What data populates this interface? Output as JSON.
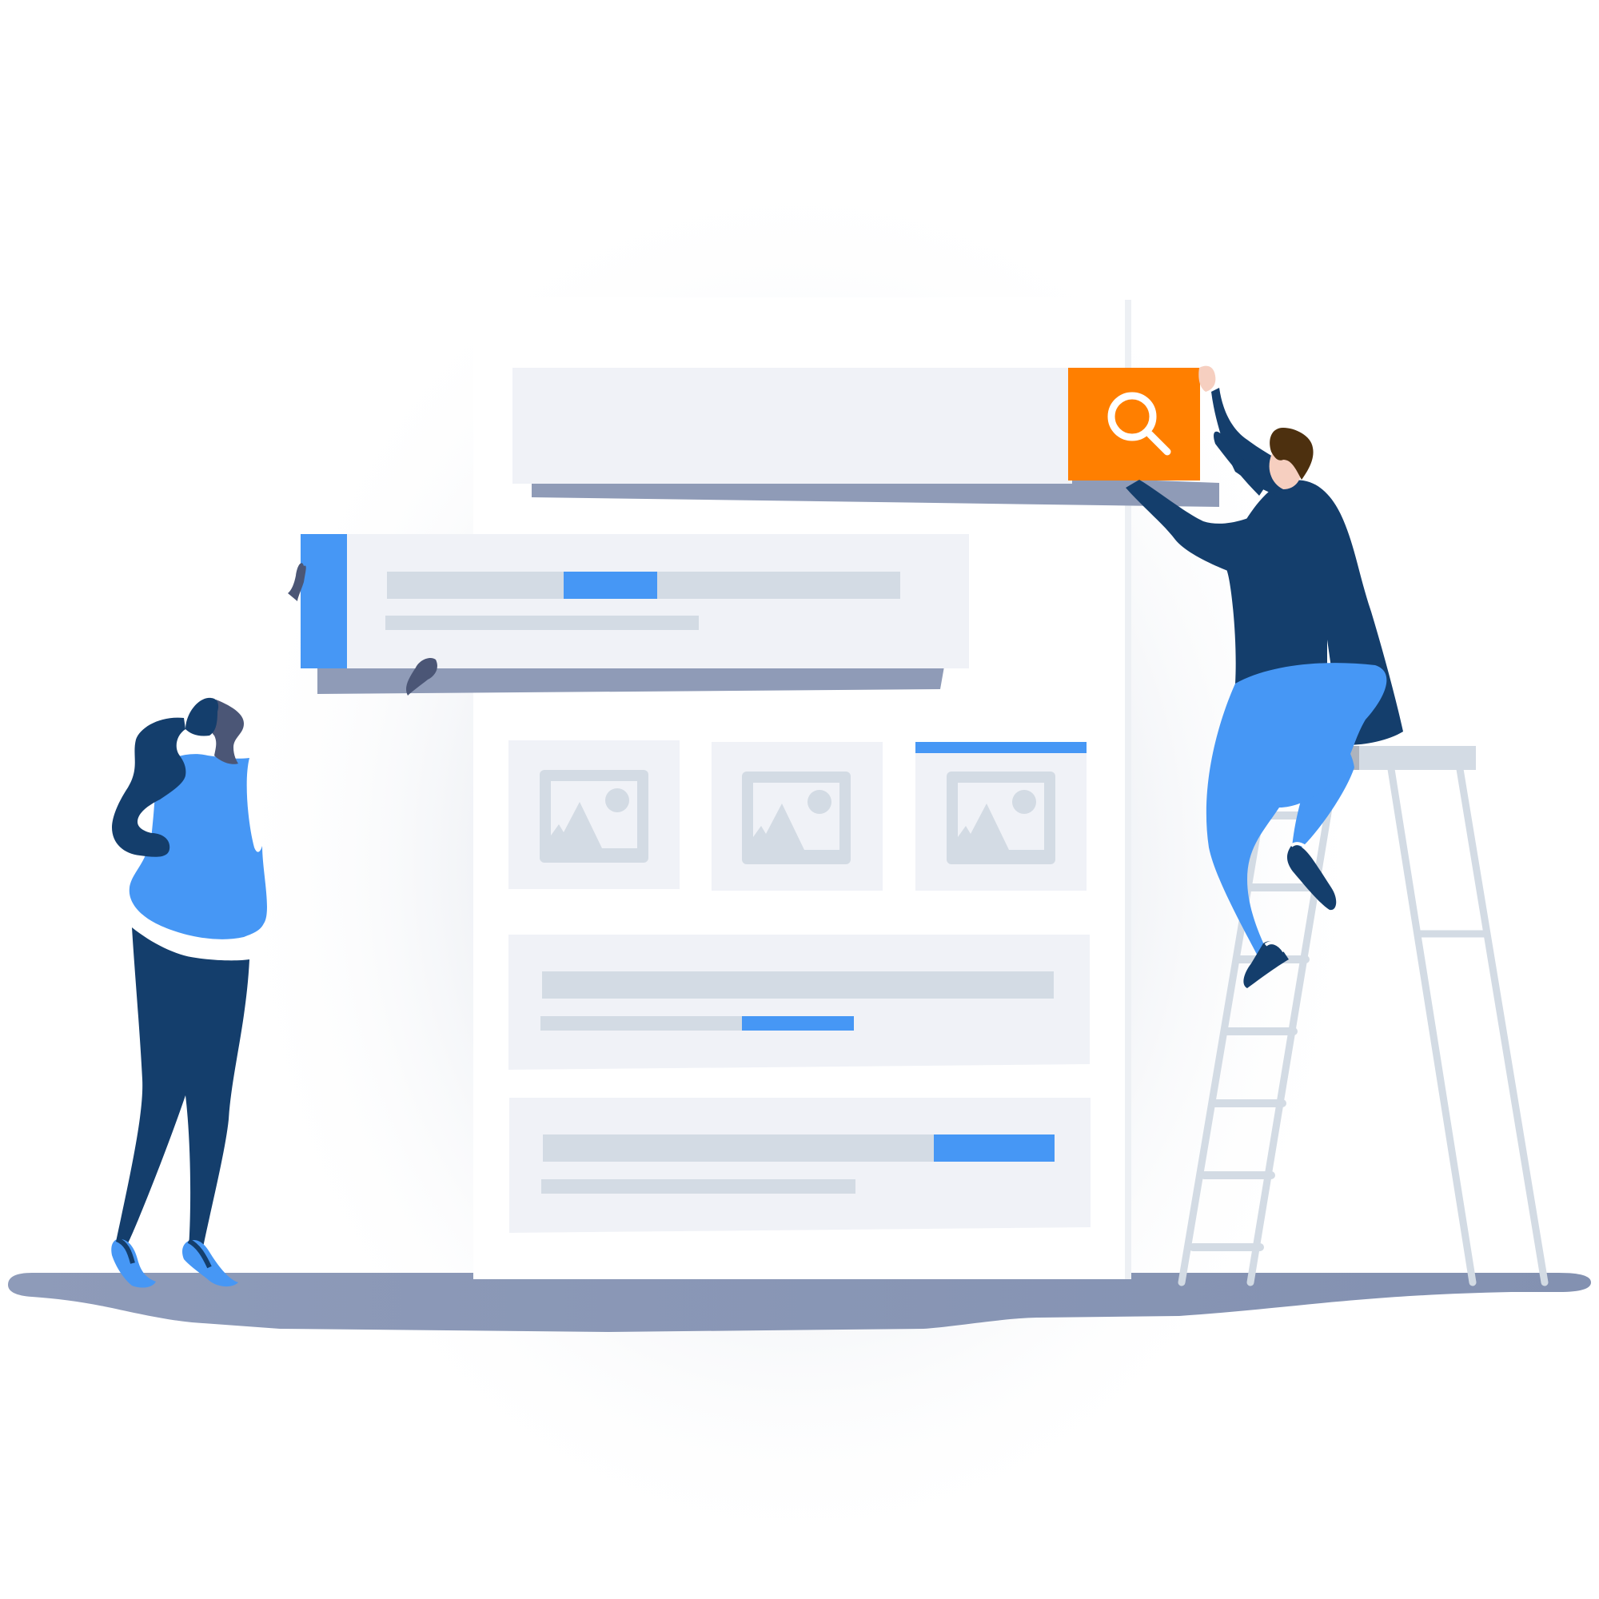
{
  "illustration": {
    "kind": "website-wireframe-building",
    "colors": {
      "background": "#ffffff",
      "page": "#ffffff",
      "panel": "#f0f2f7",
      "placeholder": "#d3dbe4",
      "accent_blue": "#4697f5",
      "accent_orange": "#ff7f00",
      "shadow": "#8f9bb7",
      "navy": "#143e6c",
      "ground": "#8a97b7",
      "skin": "#f6cfc0",
      "hair": "#4d300f"
    },
    "icons": {
      "search_button_icon": "search-icon",
      "image_placeholder_icon": "image-placeholder-icon"
    },
    "search_bar": {
      "placeholder": "",
      "button_color": "#ff7f00"
    },
    "image_cards_count": 3,
    "people": [
      "woman-standing",
      "man-on-ladder"
    ]
  }
}
